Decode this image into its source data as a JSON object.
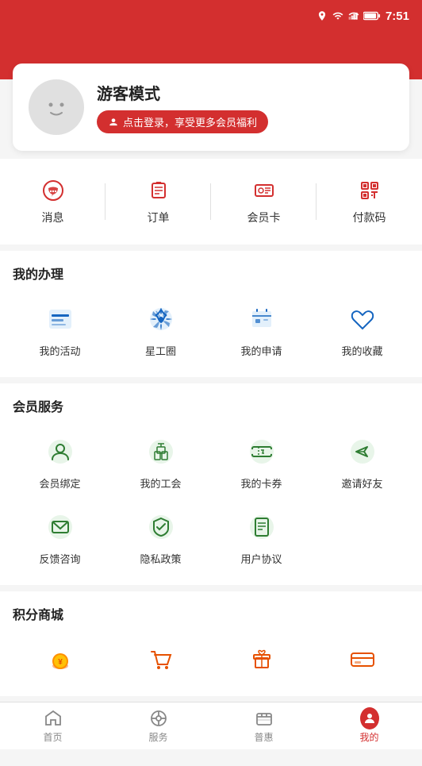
{
  "statusBar": {
    "time": "7:51"
  },
  "profile": {
    "name": "游客模式",
    "loginPrompt": "点击登录，享受更多会员福利"
  },
  "quickActions": [
    {
      "id": "message",
      "label": "消息",
      "icon": "chat"
    },
    {
      "id": "order",
      "label": "订单",
      "icon": "order"
    },
    {
      "id": "membercard",
      "label": "会员卡",
      "icon": "card"
    },
    {
      "id": "paycode",
      "label": "付款码",
      "icon": "qrcode"
    }
  ],
  "mySection": {
    "title": "我的办理",
    "items": [
      {
        "id": "myactivities",
        "label": "我的活动",
        "icon": "box"
      },
      {
        "id": "starcircle",
        "label": "星工圈",
        "icon": "spinner"
      },
      {
        "id": "myapply",
        "label": "我的申请",
        "icon": "calendar"
      },
      {
        "id": "myfavorite",
        "label": "我的收藏",
        "icon": "star"
      }
    ]
  },
  "memberSection": {
    "title": "会员服务",
    "items": [
      {
        "id": "memberbind",
        "label": "会员绑定",
        "icon": "person"
      },
      {
        "id": "myunion",
        "label": "我的工会",
        "icon": "building"
      },
      {
        "id": "mycoupon",
        "label": "我的卡券",
        "icon": "ticket"
      },
      {
        "id": "invitefriend",
        "label": "邀请好友",
        "icon": "send"
      },
      {
        "id": "feedback",
        "label": "反馈咨询",
        "icon": "mail"
      },
      {
        "id": "privacy",
        "label": "隐私政策",
        "icon": "shield"
      },
      {
        "id": "agreement",
        "label": "用户协议",
        "icon": "document"
      }
    ]
  },
  "pointsSection": {
    "title": "积分商城"
  },
  "bottomNav": [
    {
      "id": "home",
      "label": "首页",
      "active": false
    },
    {
      "id": "service",
      "label": "服务",
      "active": false
    },
    {
      "id": "welfare",
      "label": "普惠",
      "active": false
    },
    {
      "id": "mine",
      "label": "我的",
      "active": true
    }
  ]
}
